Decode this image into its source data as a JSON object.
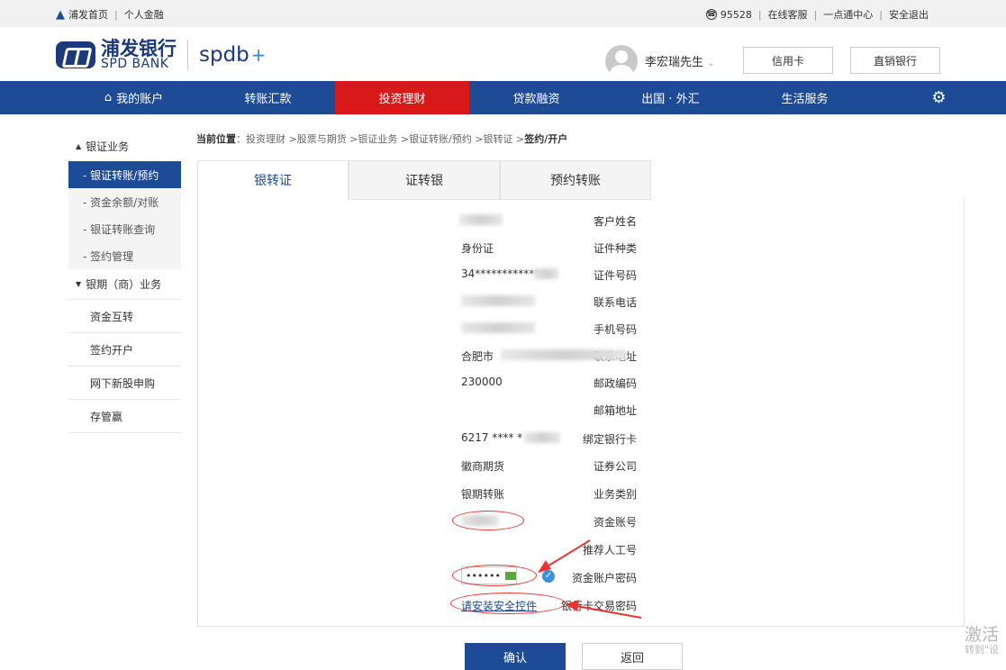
{
  "topbar": {
    "home": "浦发首页",
    "personal": "个人金融",
    "phone": "95528",
    "service": "在线客服",
    "center": "一点通中心",
    "logout": "安全退出"
  },
  "header": {
    "logo_cn": "浦发银行",
    "logo_en": "SPD BANK",
    "brand": "spdb",
    "brand_plus": "+",
    "user": "李宏瑞先生",
    "credit_card": "信用卡",
    "direct_bank": "直销银行"
  },
  "nav": {
    "items": [
      "我的账户",
      "转账汇款",
      "投资理财",
      "贷款融资",
      "出国 · 外汇",
      "生活服务"
    ]
  },
  "sidebar": {
    "group1": "银证业务",
    "subitems": [
      "- 银证转账/预约",
      "- 资金余额/对账",
      "- 银证转账查询",
      "- 签约管理"
    ],
    "group2": "银期（商）业务",
    "items": [
      "资金互转",
      "签约开户",
      "网下新股申购",
      "存管赢"
    ]
  },
  "breadcrumb": {
    "prefix": "当前位置",
    "path": "：投资理财 >股票与期货 >银证业务 >银证转账/预约 >银转证 >",
    "current": "签约/开户"
  },
  "tabs": [
    "银转证",
    "证转银",
    "预约转账"
  ],
  "form": {
    "customer_name_label": "客户姓名",
    "id_type_label": "证件种类",
    "id_type": "身份证",
    "id_number_label": "证件号码",
    "id_number": "34************",
    "phone_label": "联系电话",
    "mobile_label": "手机号码",
    "address_label": "联系地址",
    "address": "合肥市",
    "postcode_label": "邮政编码",
    "postcode": "230000",
    "email_label": "邮箱地址",
    "bank_card_label": "绑定银行卡",
    "bank_card": "6217 **** *",
    "broker_label": "证券公司",
    "broker": "徽商期货",
    "business_label": "业务类别",
    "business": "银期转账",
    "account_label": "资金账号",
    "referrer_label": "推荐人工号",
    "account_pwd_label": "资金账户密码",
    "account_pwd": "••••••",
    "card_pwd_label": "银行卡交易密码",
    "card_pwd_link": "请安装安全控件"
  },
  "buttons": {
    "confirm": "确认",
    "back": "返回"
  },
  "watermark": {
    "line1": "激活",
    "line2": "转到\"设"
  },
  "colors": {
    "brand_blue": "#1d4b95",
    "active_red": "#d7191a",
    "annotation_red": "#ee3333"
  }
}
